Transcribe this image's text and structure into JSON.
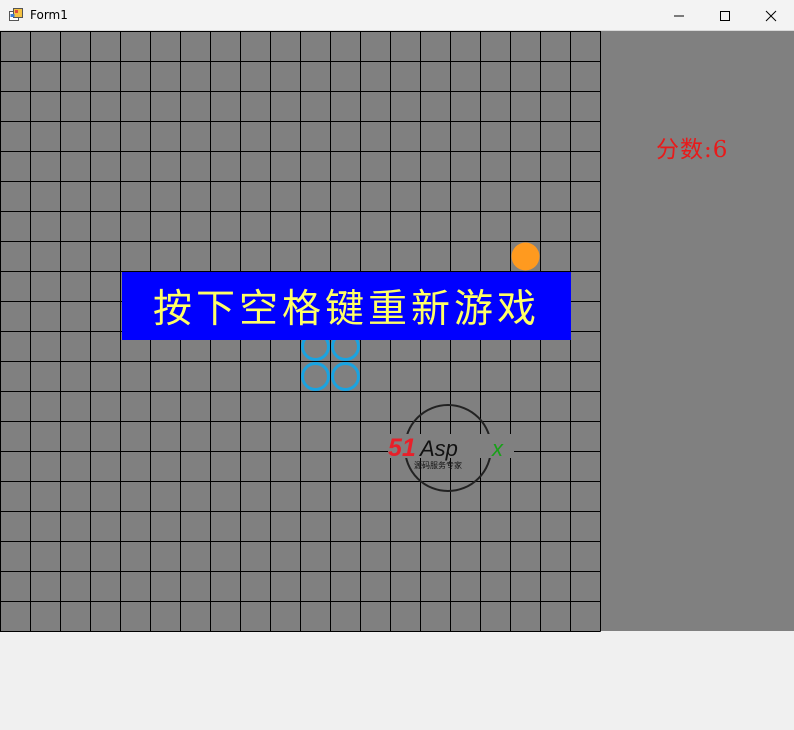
{
  "window": {
    "title": "Form1",
    "icon": "windows-form-icon",
    "controls": [
      "minimize-icon",
      "maximize-icon",
      "close-icon"
    ]
  },
  "game": {
    "board_cols": 20,
    "board_rows": 20,
    "score_text": "分数:6",
    "overlay_text": "按下空格键重新游戏",
    "food": {
      "col": 17,
      "row": 7,
      "color": "#ff9a1f"
    },
    "snake": {
      "color": "#1aa3e0",
      "cells": [
        {
          "col": 10,
          "row": 10
        },
        {
          "col": 11,
          "row": 10
        },
        {
          "col": 10,
          "row": 11
        },
        {
          "col": 11,
          "row": 11
        }
      ]
    },
    "colors": {
      "board_bg": "#808080",
      "grid_line": "#000000",
      "score": "#e81a1a",
      "overlay_bg": "#0000ff",
      "overlay_text": "#ffff66"
    }
  },
  "watermark": {
    "logo_main": "51Aspx",
    "logo_sub": "源码服务专家"
  }
}
